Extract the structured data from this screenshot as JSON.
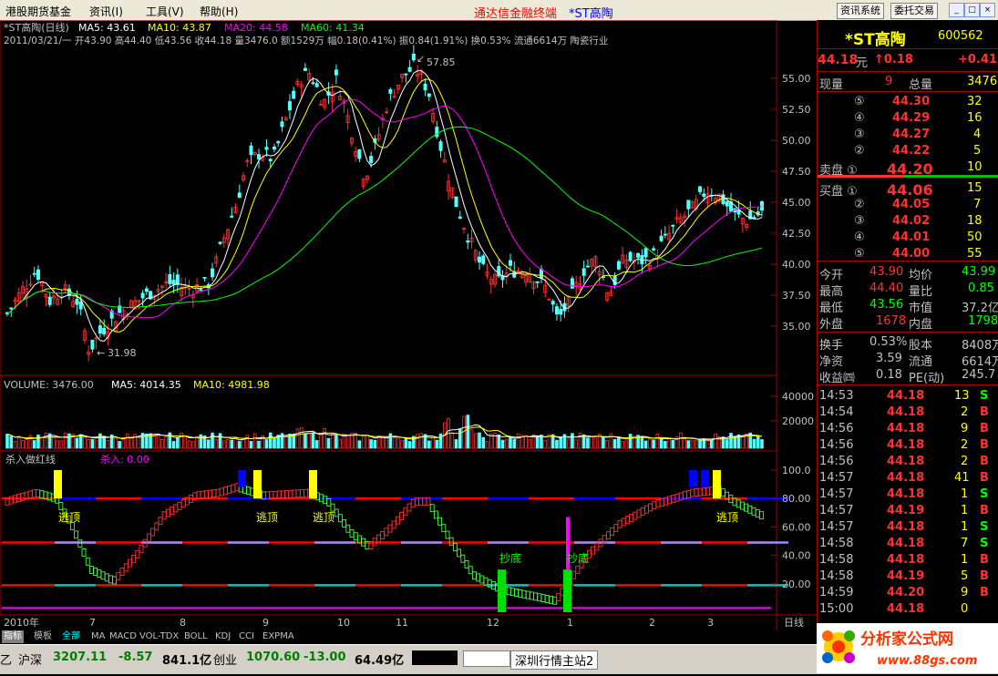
{
  "menu": {
    "items": [
      "港股期货基金",
      "资讯(I)",
      "工具(V)",
      "帮助(H)"
    ],
    "title": "通达信金融终端",
    "stock_title": "*ST高陶",
    "buttons": [
      "资讯系统",
      "委托交易"
    ]
  },
  "main_chart": {
    "header_name": "*ST高陶(日线)",
    "ma5": "MA5: 43.61",
    "ma10": "MA10: 43.87",
    "ma20": "MA20: 44.58",
    "ma60": "MA60: 41.34",
    "info_line": "2011/03/21/一 开43.90 高44.40 低43.56 收44.18 量3476.0 额1529万 幅0.18(0.41%) 振0.84(1.91%) 换0.53% 流通6614万 陶瓷行业",
    "high_label": "57.85",
    "low_label": "31.98",
    "y_ticks": [
      "55.00",
      "52.50",
      "50.00",
      "47.50",
      "45.00",
      "42.50",
      "40.00",
      "37.50",
      "35.00"
    ],
    "colors": {
      "up": "#ff3232",
      "down": "#54ffff",
      "ma5": "#ffffff",
      "ma10": "#ffff00",
      "ma20": "#ff00ff",
      "ma60": "#00ff00"
    }
  },
  "volume_chart": {
    "label": "VOLUME: 3476.00",
    "ma5": "MA5: 4014.35",
    "ma10": "MA10: 4981.98",
    "y_ticks": [
      "40000",
      "20000"
    ]
  },
  "indicator_chart": {
    "name": "杀入做红线",
    "sub": "杀入: 0.00",
    "y_ticks": [
      "100.0",
      "80.00",
      "60.00",
      "40.00",
      "20.00"
    ],
    "labels": [
      "逃顶",
      "逃顶",
      "逃顶",
      "逃顶",
      "抄底",
      "抄底"
    ]
  },
  "x_axis": {
    "labels": [
      "2010年",
      "7",
      "8",
      "9",
      "10",
      "11",
      "12",
      "1",
      "2",
      "3"
    ],
    "period": "日线"
  },
  "tabs": [
    "指标",
    "模板",
    "全部",
    "MA",
    "MACD",
    "VOL-TDX",
    "BOLL",
    "KDJ",
    "CCI",
    "EXPMA"
  ],
  "quote": {
    "name": "*ST高陶",
    "code": "600562",
    "price": "44.18",
    "unit": "元",
    "change": "↑0.18",
    "change_pct": "+0.41",
    "now_vol_label": "现量",
    "now_vol": "9",
    "total_vol_label": "总量",
    "total_vol": "3476",
    "sell": [
      {
        "lvl": "⑤",
        "price": "44.30",
        "vol": "32"
      },
      {
        "lvl": "④",
        "price": "44.29",
        "vol": "16"
      },
      {
        "lvl": "③",
        "price": "44.27",
        "vol": "4"
      },
      {
        "lvl": "②",
        "price": "44.22",
        "vol": "5"
      },
      {
        "lvl": "卖盘 ①",
        "price": "44.20",
        "vol": "10"
      }
    ],
    "buy": [
      {
        "lvl": "买盘 ①",
        "price": "44.06",
        "vol": "15"
      },
      {
        "lvl": "②",
        "price": "44.05",
        "vol": "7"
      },
      {
        "lvl": "③",
        "price": "44.02",
        "vol": "18"
      },
      {
        "lvl": "④",
        "price": "44.01",
        "vol": "50"
      },
      {
        "lvl": "⑤",
        "price": "44.00",
        "vol": "55"
      }
    ],
    "stats": [
      [
        "今开",
        "43.90",
        "均价",
        "43.99"
      ],
      [
        "最高",
        "44.40",
        "量比",
        "0.85"
      ],
      [
        "最低",
        "43.56",
        "市值",
        "37.2亿"
      ],
      [
        "外盘",
        "1678",
        "内盘",
        "1798"
      ]
    ],
    "stats2": [
      [
        "换手",
        "0.53%",
        "股本",
        "8408万"
      ],
      [
        "净资",
        "3.59",
        "流通",
        "6614万"
      ],
      [
        "收益㈣",
        "0.18",
        "PE(动)",
        "245.7"
      ]
    ],
    "ticks": [
      [
        "14:53",
        "44.18",
        "13",
        "S"
      ],
      [
        "14:54",
        "44.18",
        "2",
        "B"
      ],
      [
        "14:56",
        "44.18",
        "9",
        "B"
      ],
      [
        "14:56",
        "44.18",
        "2",
        "B"
      ],
      [
        "14:56",
        "44.18",
        "2",
        "B"
      ],
      [
        "14:57",
        "44.18",
        "41",
        "B"
      ],
      [
        "14:57",
        "44.18",
        "1",
        "S"
      ],
      [
        "14:57",
        "44.19",
        "1",
        "B"
      ],
      [
        "14:57",
        "44.18",
        "1",
        "S"
      ],
      [
        "14:58",
        "44.18",
        "7",
        "S"
      ],
      [
        "14:58",
        "44.18",
        "1",
        "B"
      ],
      [
        "14:58",
        "44.19",
        "5",
        "B"
      ],
      [
        "14:59",
        "44.20",
        "9",
        "B"
      ],
      [
        "15:00",
        "44.18",
        "0",
        ""
      ]
    ]
  },
  "status": {
    "left": "乙",
    "hs_label": "沪深",
    "hs_val": "3207.11",
    "hs_chg": "-8.57",
    "hs_amt": "841.1亿",
    "cy_label": "创业",
    "cy_val": "1070.60",
    "cy_chg": "-13.00",
    "cy_amt": "64.49亿",
    "server": "深圳行情主站2"
  },
  "logo": {
    "text": "分析家公式网",
    "url": "www.88gs.com"
  }
}
